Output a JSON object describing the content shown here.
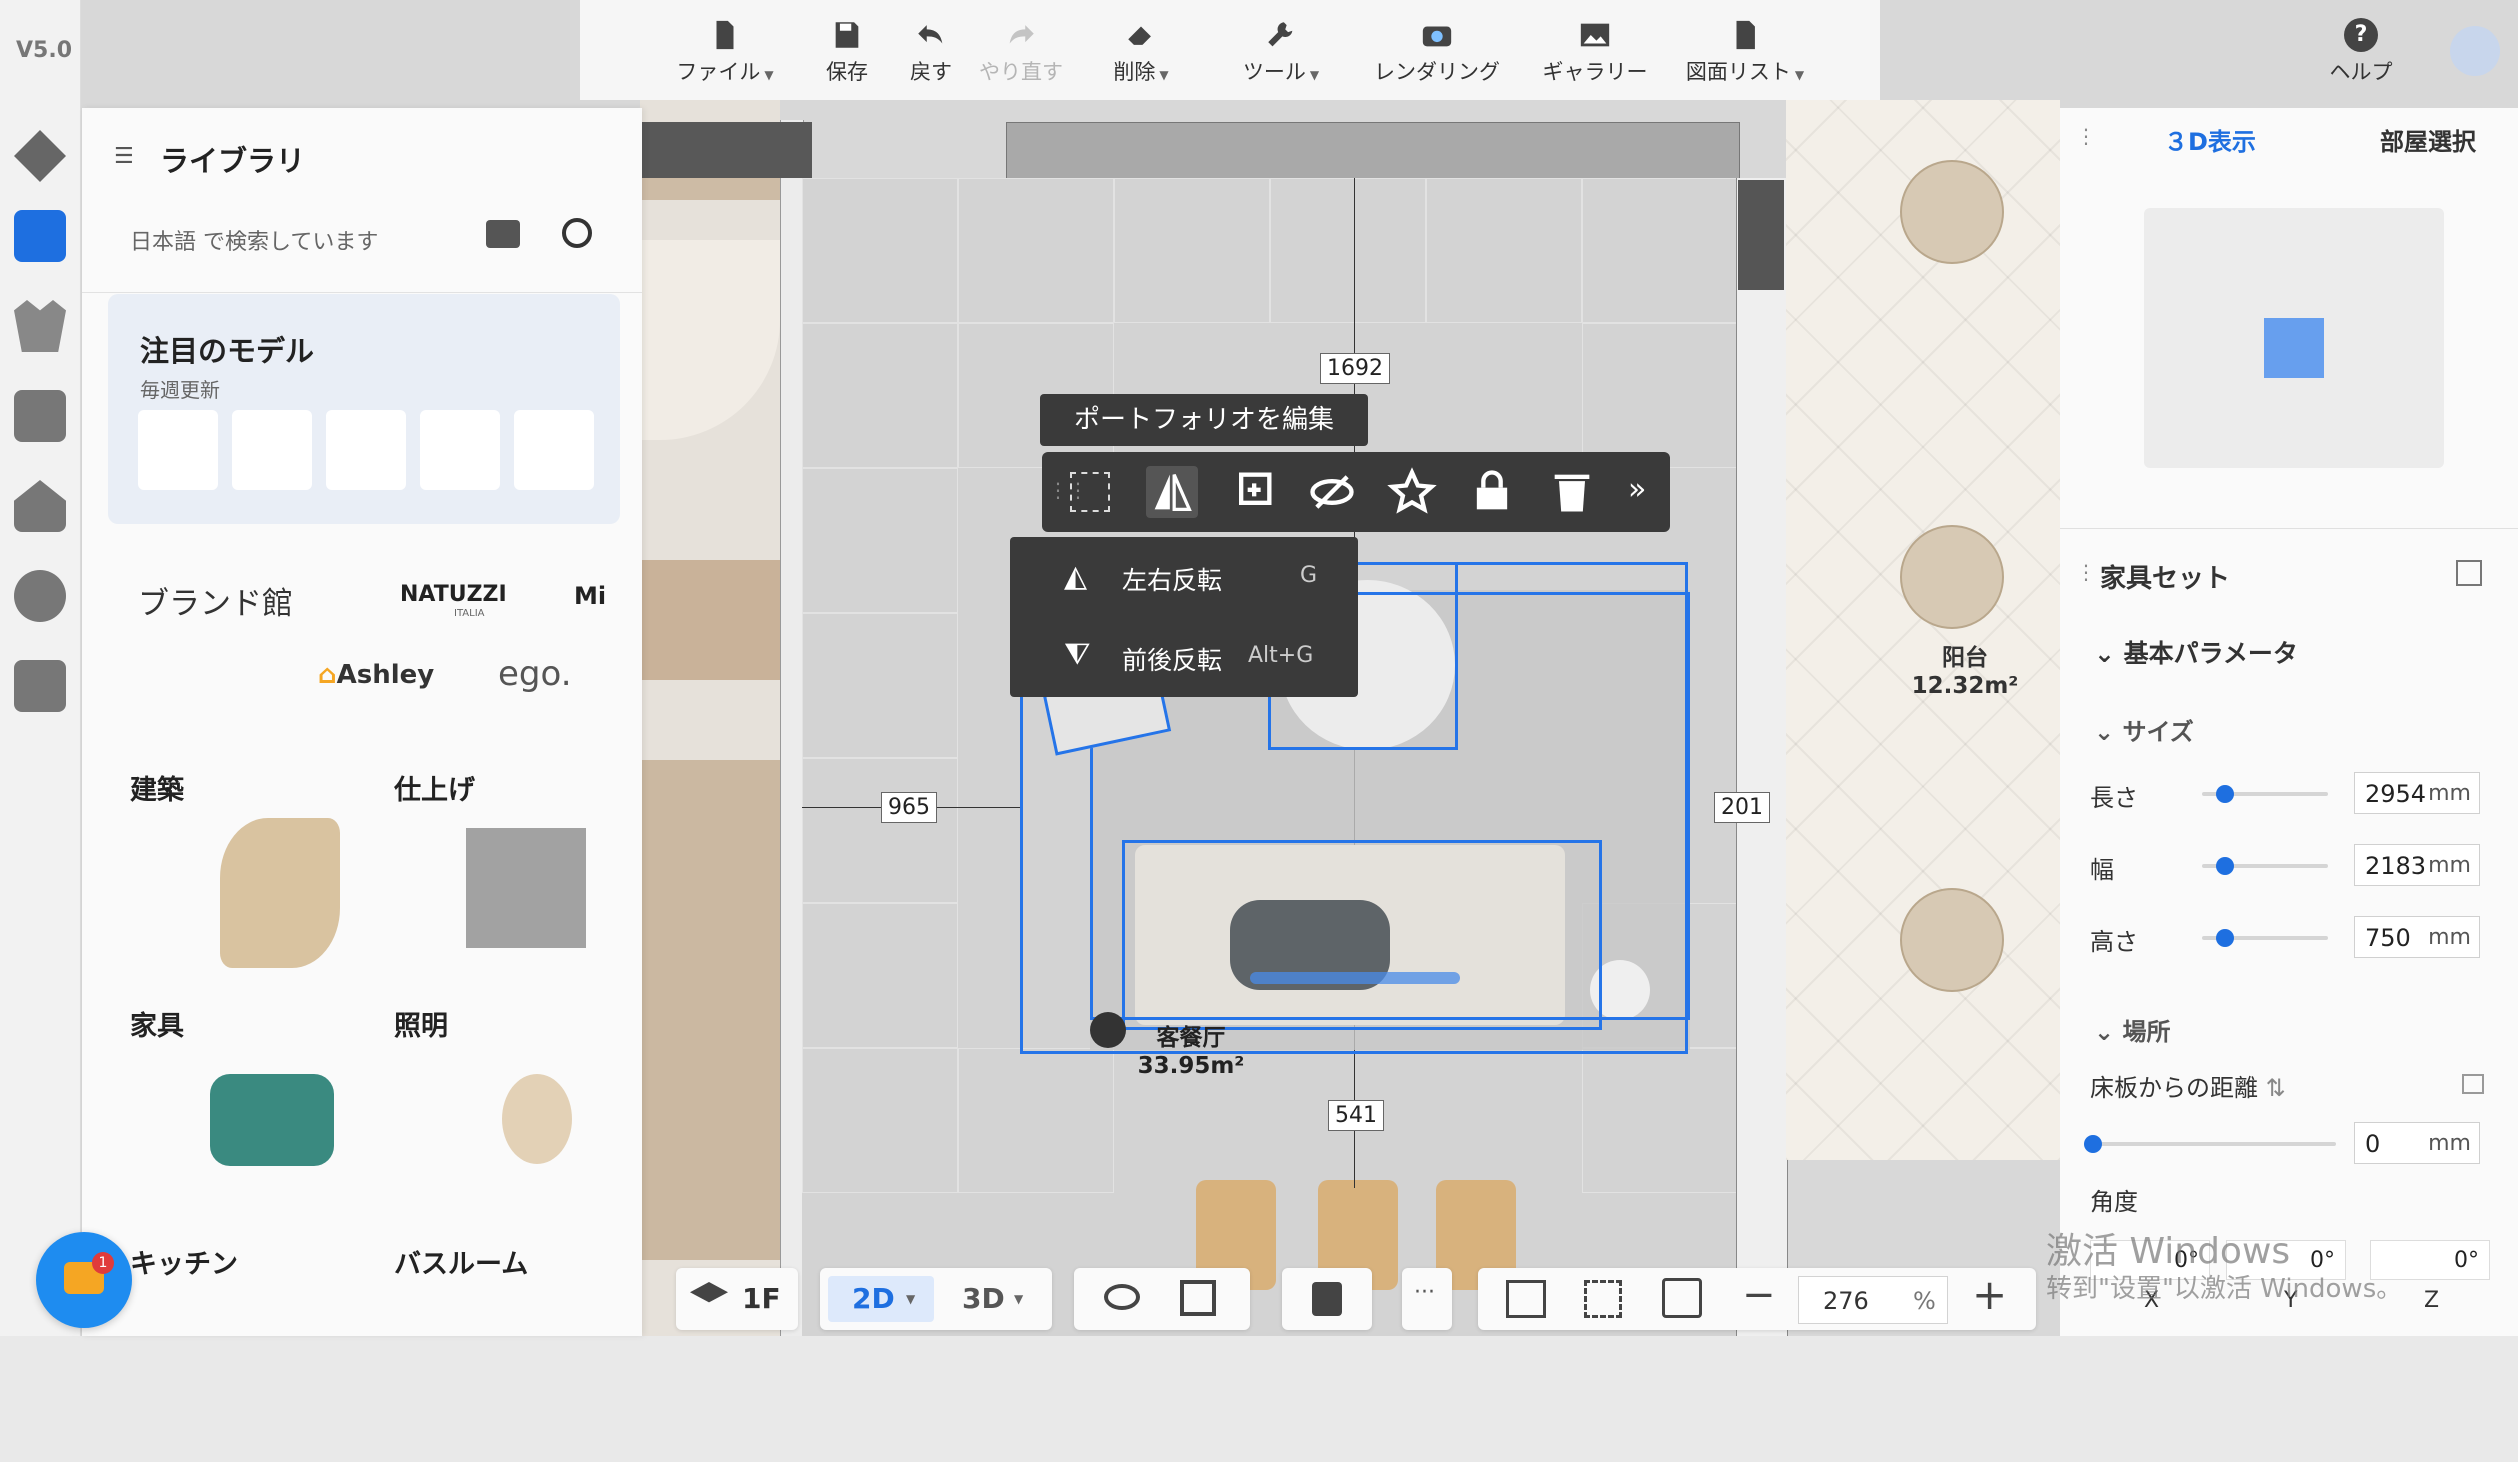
{
  "version": "V5.0",
  "toolbar": {
    "file": "ファイル",
    "save": "保存",
    "undo": "戻す",
    "redo": "やり直す",
    "delete": "削除",
    "tools": "ツール",
    "render": "レンダリング",
    "gallery": "ギャラリー",
    "drawings": "図面リスト",
    "help": "ヘルプ"
  },
  "library": {
    "title": "ライブラリ",
    "search_placeholder": "日本語 で検索しています",
    "featured_title": "注目のモデル",
    "featured_sub": "毎週更新",
    "brand_title": "ブランド館",
    "brands": [
      "NATUZZI",
      "ITALIA",
      "Mi",
      "Ashley",
      "ego."
    ],
    "categories": [
      "建築",
      "仕上げ",
      "家具",
      "照明",
      "キッチン",
      "バスルーム"
    ]
  },
  "canvas": {
    "dims": [
      "1692",
      "965",
      "201",
      "541"
    ],
    "room_living_name": "客餐厅",
    "room_living_area": "33.95m²",
    "room_balcony_name": "阳台",
    "room_balcony_area": "12.32m²",
    "tooltip": "ポートフォリオを編集",
    "flip_lr": "左右反転",
    "flip_lr_key": "G",
    "flip_fb": "前後反転",
    "flip_fb_key": "Alt+G"
  },
  "right_panel": {
    "tab_3d": "３D表示",
    "tab_room": "部屋選択",
    "set_title": "家具セット",
    "basic_params": "基本パラメータ",
    "size": "サイズ",
    "length_label": "長さ",
    "length_value": "2954",
    "width_label": "幅",
    "width_value": "2183",
    "height_label": "高さ",
    "height_value": "750",
    "unit": "mm",
    "place": "場所",
    "floor_distance": "床板からの距離",
    "floor_value": "0",
    "angle": "角度",
    "angle_x": "0°",
    "angle_y": "0°",
    "angle_z": "0°",
    "axis_x": "X",
    "axis_y": "Y",
    "axis_z": "Z",
    "slider_length_pct": 20,
    "slider_width_pct": 20,
    "slider_height_pct": 20
  },
  "bottom": {
    "floor": "1F",
    "view2d": "2D",
    "view3d": "3D",
    "more": "···",
    "zoom": "276",
    "zoom_unit": "%"
  },
  "watermark": {
    "line1": "激活 Windows",
    "line2": "转到\"设置\"以激活 Windows。"
  },
  "chat_badge": "1",
  "colors": {
    "accent": "#1e6fe0",
    "selection": "#2574e8",
    "dark_popup": "#3a3a3a"
  }
}
